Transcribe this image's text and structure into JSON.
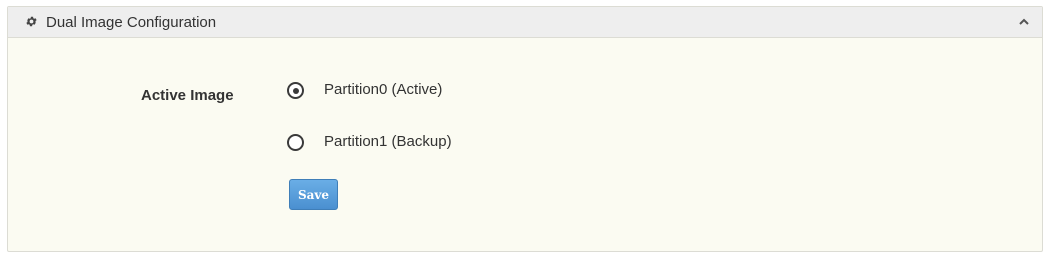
{
  "panel": {
    "title": "Dual Image Configuration",
    "header_icon": "gear-icon",
    "collapse_icon": "chevron-up-icon"
  },
  "form": {
    "active_image_label": "Active Image",
    "options": [
      {
        "label": "Partition0 (Active)",
        "selected": true
      },
      {
        "label": "Partition1 (Backup)",
        "selected": false
      }
    ],
    "save_label": "Save"
  },
  "colors": {
    "panel_background": "#fbfbf2",
    "header_background": "#eeeeee",
    "button_blue": "#4a8fd0"
  }
}
